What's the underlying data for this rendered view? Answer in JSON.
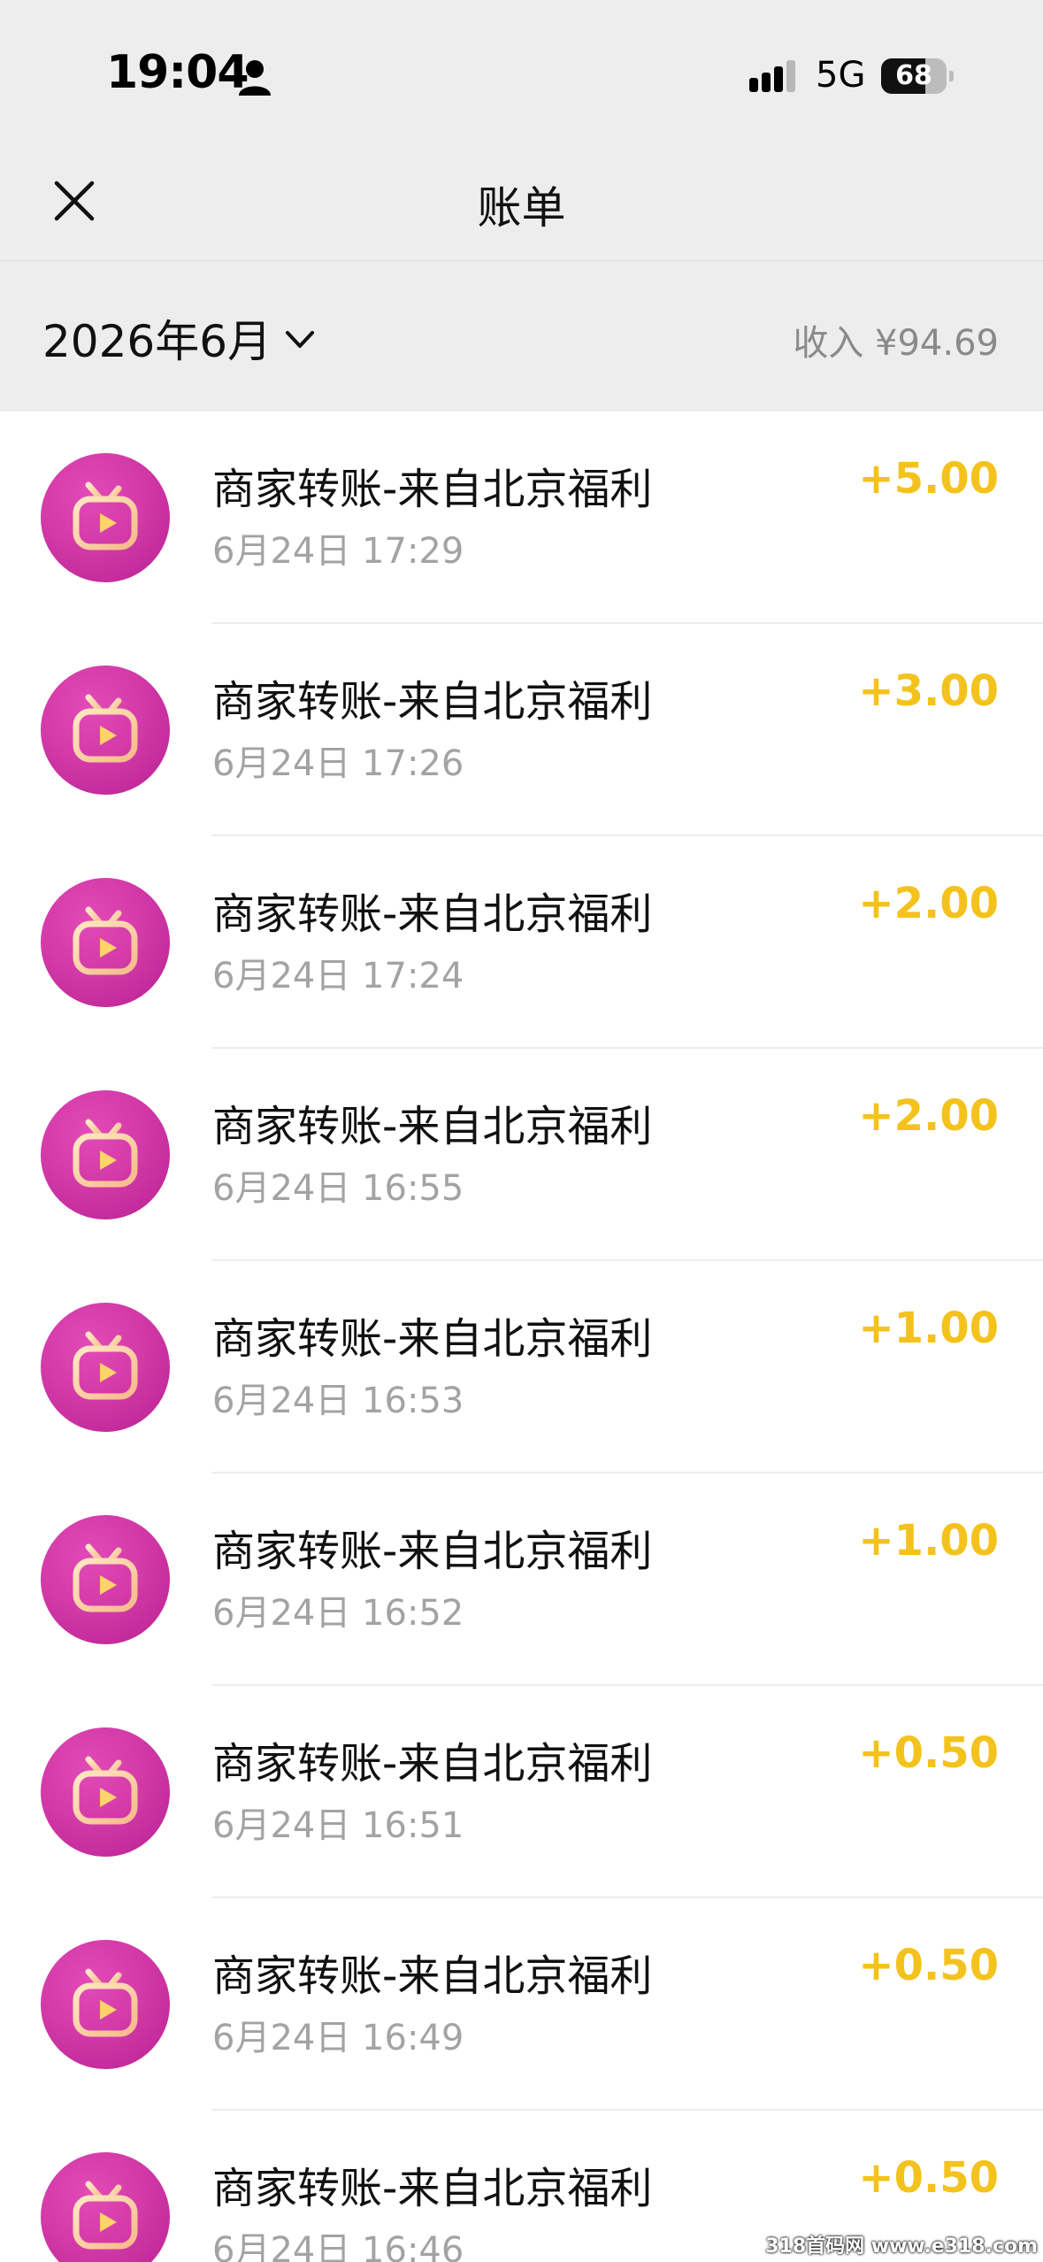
{
  "status_bar": {
    "time": "19:04",
    "network": "5G",
    "battery": "68",
    "battery_level": 0.68
  },
  "nav": {
    "title": "账单",
    "close_icon": "close-icon"
  },
  "filter": {
    "month": "2026年6月",
    "income": "收入 ¥94.69"
  },
  "colors": {
    "amount": "#f4c21c",
    "icon_bg": "#d33aa8"
  },
  "transactions": [
    {
      "title": "商家转账-来自北京福利",
      "time": "6月24日 17:29",
      "amount": "+5.00"
    },
    {
      "title": "商家转账-来自北京福利",
      "time": "6月24日 17:26",
      "amount": "+3.00"
    },
    {
      "title": "商家转账-来自北京福利",
      "time": "6月24日 17:24",
      "amount": "+2.00"
    },
    {
      "title": "商家转账-来自北京福利",
      "time": "6月24日 16:55",
      "amount": "+2.00"
    },
    {
      "title": "商家转账-来自北京福利",
      "time": "6月24日 16:53",
      "amount": "+1.00"
    },
    {
      "title": "商家转账-来自北京福利",
      "time": "6月24日 16:52",
      "amount": "+1.00"
    },
    {
      "title": "商家转账-来自北京福利",
      "time": "6月24日 16:51",
      "amount": "+0.50"
    },
    {
      "title": "商家转账-来自北京福利",
      "time": "6月24日 16:49",
      "amount": "+0.50"
    },
    {
      "title": "商家转账-来自北京福利",
      "time": "6月24日 16:46",
      "amount": "+0.50"
    }
  ],
  "watermark": "318首码网 www.e318.com"
}
